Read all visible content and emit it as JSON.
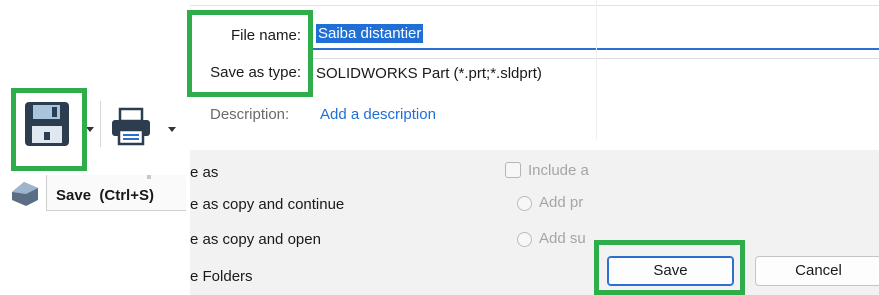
{
  "toolbar": {
    "save_icon": "floppy-disk-icon",
    "print_icon": "printer-icon",
    "tooltip": {
      "label": "Save",
      "shortcut": "(Ctrl+S)"
    }
  },
  "dialog": {
    "file_name_label": "File name:",
    "file_name_value": "Saiba distantier",
    "save_as_type_label": "Save as type:",
    "save_as_type_value": "SOLIDWORKS Part (*.prt;*.sldprt)",
    "description_label": "Description:",
    "description_link": "Add a description",
    "options": {
      "save_as": "e as",
      "save_as_copy_continue": "e as copy and continue",
      "save_as_copy_open": "e as copy and open",
      "folders": "e Folders",
      "include_checkbox_label": "Include a",
      "radio_add_prefix": "Add pr",
      "radio_add_suffix": "Add su"
    },
    "save_button": "Save",
    "cancel_button": "Cancel"
  },
  "colors": {
    "highlight": "#2fad4a",
    "accent_blue": "#1f6fd6",
    "panel_gray": "#f2f2f2"
  }
}
